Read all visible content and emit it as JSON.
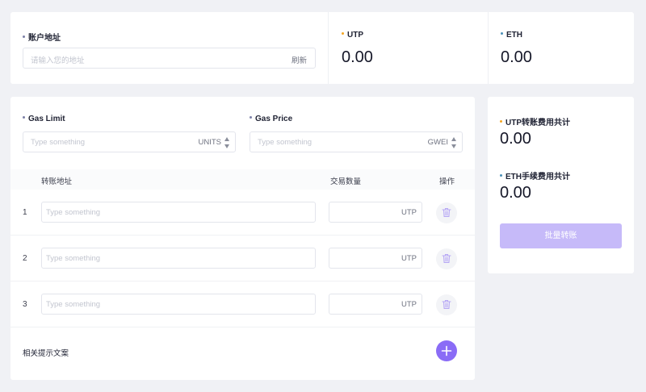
{
  "colors": {
    "addr_dot": "#7d81a8",
    "utp_dot": "#f5a623",
    "eth_dot": "#4a90b8",
    "accent": "#8a6cf6",
    "accent_disabled": "#c6baf9"
  },
  "account": {
    "label": "账户地址",
    "placeholder": "请输入您的地址",
    "refresh_label": "刷新"
  },
  "balances": {
    "utp": {
      "label": "UTP",
      "value": "0.00"
    },
    "eth": {
      "label": "ETH",
      "value": "0.00"
    }
  },
  "gas": {
    "limit": {
      "label": "Gas Limit",
      "placeholder": "Type something",
      "unit": "UNITS"
    },
    "price": {
      "label": "Gas Price",
      "placeholder": "Type something",
      "unit": "GWEI"
    }
  },
  "table": {
    "headers": {
      "address": "转账地址",
      "amount": "交易数量",
      "action": "操作"
    },
    "rows": [
      {
        "index": "1",
        "address_placeholder": "Type something",
        "amount_unit": "UTP"
      },
      {
        "index": "2",
        "address_placeholder": "Type something",
        "amount_unit": "UTP"
      },
      {
        "index": "3",
        "address_placeholder": "Type something",
        "amount_unit": "UTP"
      }
    ],
    "hint": "相关提示文案",
    "row_action_icon": "trash-icon",
    "add_icon": "plus-icon"
  },
  "summary": {
    "utp_fee": {
      "label": "UTP转账费用共计",
      "value": "0.00"
    },
    "eth_fee": {
      "label": "ETH手续费用共计",
      "value": "0.00"
    },
    "batch_button": "批量转账"
  }
}
